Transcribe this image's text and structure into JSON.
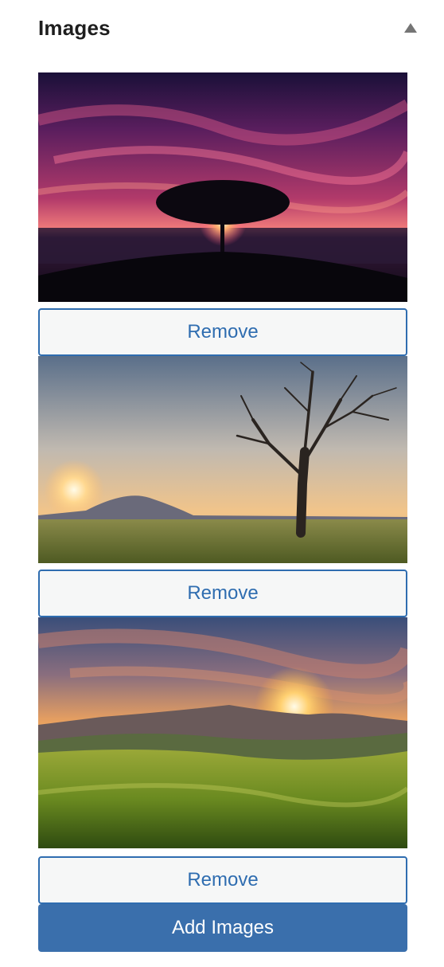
{
  "panel": {
    "title": "Images",
    "toggle_icon": "triangle-up-icon",
    "colors": {
      "accent": "#2f6db0",
      "add_button_bg": "#3a6fac",
      "remove_button_bg": "#f6f7f7",
      "title_text": "#1e1e1e",
      "toggle_icon": "#757575"
    }
  },
  "images": [
    {
      "subject": "tree-silhouette-sunset-image",
      "remove_label": "Remove"
    },
    {
      "subject": "bare-tree-meadow-sunset-image",
      "remove_label": "Remove"
    },
    {
      "subject": "mountain-meadow-sunrise-image",
      "remove_label": "Remove"
    }
  ],
  "add_button": {
    "label": "Add Images"
  }
}
